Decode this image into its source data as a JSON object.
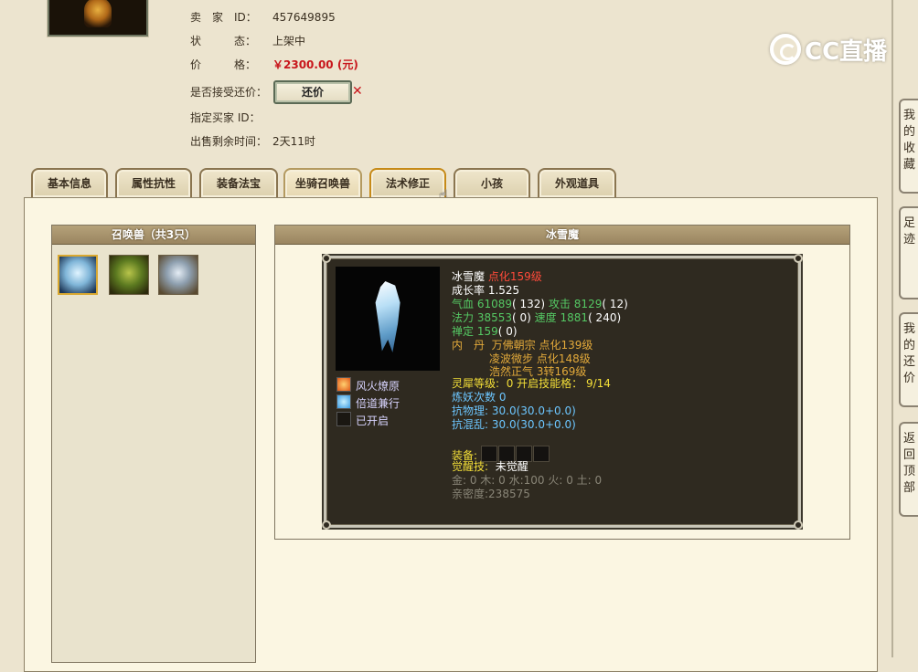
{
  "seller": {
    "id_label": "卖　家　ID：",
    "id_value": "457649895",
    "status_label": "状　　　态：",
    "status_value": "上架中",
    "price_label": "价　　　格：",
    "price_value": "￥2300.00 (元)",
    "counter_label": "是否接受还价：",
    "counter_button": "还价",
    "counter_close": "✕",
    "buyer_label": "指定买家 ID：",
    "remaining_label": "出售剩余时间：",
    "remaining_value": "2天11时"
  },
  "watermark": {
    "text": "CC直播"
  },
  "tabs": [
    {
      "label": "基本信息"
    },
    {
      "label": "属性抗性"
    },
    {
      "label": "装备法宝"
    },
    {
      "label": "坐骑召唤兽"
    },
    {
      "label": "法术修正"
    },
    {
      "label": "小孩"
    },
    {
      "label": "外观道具"
    }
  ],
  "pet_list": {
    "header": "召唤兽（共3只）",
    "pets": [
      {
        "icon": "ice-demon-icon",
        "selected": true
      },
      {
        "icon": "green-demon-icon",
        "selected": false
      },
      {
        "icon": "armored-pet-icon",
        "selected": false
      }
    ]
  },
  "detail": {
    "header": "冰雪魔",
    "name": "冰雪魔",
    "level": "点化159级",
    "growth": "成长率 1.525",
    "hp_label": "气血",
    "hp": "61089",
    "hp_extra": "( 132)",
    "atk_label": "攻击",
    "atk": "8129",
    "atk_extra": "( 12)",
    "mp_label": "法力",
    "mp": "38553",
    "mp_extra": "( 0)",
    "spd_label": "速度",
    "spd": "1881",
    "spd_extra": "( 240)",
    "zen_label": "禅定",
    "zen": "159",
    "zen_extra": "( 0)",
    "inner_label": "内　丹",
    "inner1": "万佛朝宗 点化139级",
    "inner2": "凌波微步 点化148级",
    "inner3": "浩然正气 3转169级",
    "spirit_label": "灵犀等级:",
    "spirit_value": "0 开启技能格：",
    "spirit_slots": "9/14",
    "refine": "炼妖次数 0",
    "phys_label": "抗物理:",
    "phys": "30.0(30.0+0.0)",
    "chaos_label": "抗混乱:",
    "chaos": "30.0(30.0+0.0)",
    "equip_label": "装备:",
    "awaken_label": "觉醒技:",
    "awaken_value": "未觉醒",
    "elements": "金: 0 木: 0 水:100 火: 0 土: 0",
    "intimacy": "亲密度:238575",
    "skills": [
      {
        "label": "风火燎原",
        "icon": "fire-skill-icon"
      },
      {
        "label": "倍道兼行",
        "icon": "wind-skill-icon"
      },
      {
        "label": "已开启",
        "icon": "empty-slot-icon"
      }
    ]
  },
  "side_tabs": [
    {
      "label": "我的收藏"
    },
    {
      "label": "足迹"
    },
    {
      "label": "我的还价"
    },
    {
      "label": "返回顶部"
    }
  ],
  "colors": {
    "price": "#c8161c",
    "stat_green": "#55c964",
    "level_red": "#ff4a3a",
    "spirit_yellow": "#f4df38",
    "inner_orange": "#e2a93a",
    "resist_blue": "#6cc6ff"
  }
}
